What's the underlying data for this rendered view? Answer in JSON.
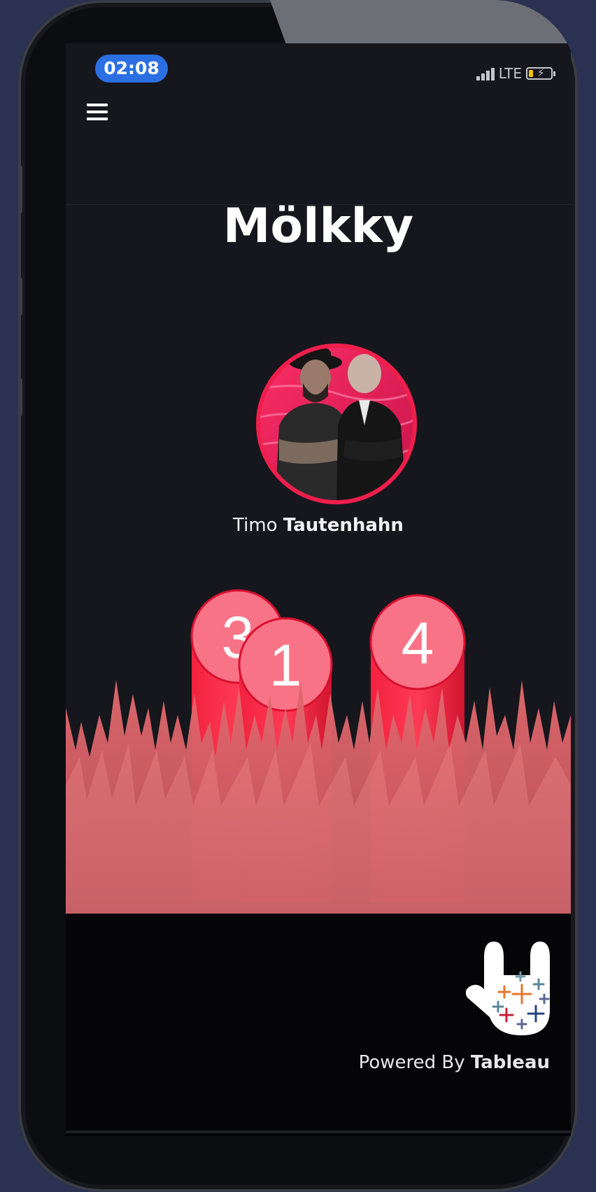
{
  "status_bar": {
    "time": "02:08",
    "network": "LTE"
  },
  "header": {
    "menu_icon": "hamburger-menu-icon"
  },
  "page": {
    "title": "Mölkky"
  },
  "player": {
    "first_name": "Timo",
    "last_name": "Tautenhahn"
  },
  "pins": [
    {
      "number": "3"
    },
    {
      "number": "1"
    },
    {
      "number": "4"
    }
  ],
  "footer": {
    "powered_prefix": "Powered By",
    "powered_brand": "Tableau",
    "logo_icon": "tableau-rock-hand-icon"
  },
  "colors": {
    "accent_blue": "#2b6fe2",
    "pin_top": "#f97386",
    "pin_body": "#f2223f",
    "grass": "#e26a6e",
    "battery": "#f2c200"
  }
}
